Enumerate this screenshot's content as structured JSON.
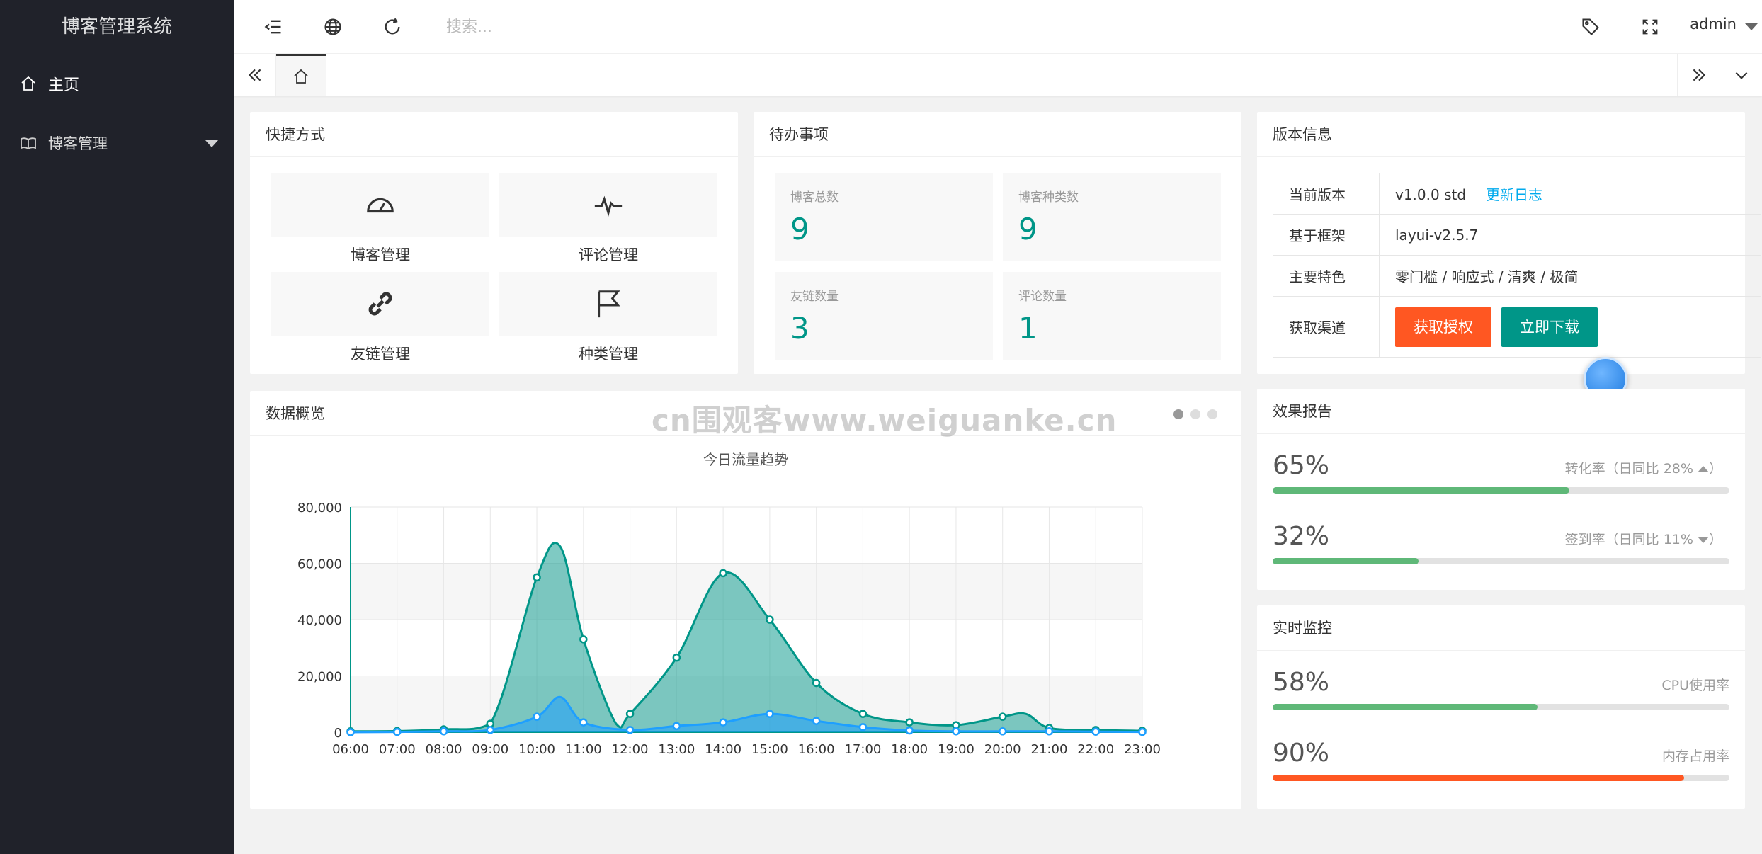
{
  "sidebar": {
    "logo": "博客管理系统",
    "items": [
      {
        "label": "主页",
        "icon": "home-icon"
      },
      {
        "label": "博客管理",
        "icon": "book-icon"
      }
    ]
  },
  "header": {
    "search_placeholder": "搜索...",
    "user": "admin"
  },
  "shortcuts": {
    "title": "快捷方式",
    "items": [
      {
        "label": "博客管理",
        "icon": "gauge-icon"
      },
      {
        "label": "评论管理",
        "icon": "pulse-icon"
      },
      {
        "label": "友链管理",
        "icon": "link-icon"
      },
      {
        "label": "种类管理",
        "icon": "flag-icon"
      }
    ]
  },
  "todo": {
    "title": "待办事项",
    "items": [
      {
        "label": "博客总数",
        "value": "9"
      },
      {
        "label": "博客种类数",
        "value": "9"
      },
      {
        "label": "友链数量",
        "value": "3"
      },
      {
        "label": "评论数量",
        "value": "1"
      }
    ]
  },
  "version": {
    "title": "版本信息",
    "rows": [
      {
        "key": "当前版本",
        "value": "v1.0.0 std",
        "link": "更新日志"
      },
      {
        "key": "基于框架",
        "value": "layui-v2.5.7"
      },
      {
        "key": "主要特色",
        "value": "零门槛 / 响应式 / 清爽 / 极简"
      },
      {
        "key": "获取渠道",
        "btn1": "获取授权",
        "btn2": "立即下载"
      }
    ]
  },
  "overview": {
    "title": "数据概览",
    "watermark": "cn围观客www.weiguanke.cn"
  },
  "chart_data": {
    "type": "area",
    "title": "今日流量趋势",
    "categories": [
      "06:00",
      "07:00",
      "08:00",
      "09:00",
      "10:00",
      "11:00",
      "12:00",
      "13:00",
      "14:00",
      "15:00",
      "16:00",
      "17:00",
      "18:00",
      "19:00",
      "20:00",
      "21:00",
      "22:00",
      "23:00"
    ],
    "ylim": [
      0,
      80000
    ],
    "yticks": [
      "0",
      "20,000",
      "40,000",
      "60,000",
      "80,000"
    ],
    "x": [
      0,
      1,
      2,
      3,
      4,
      5,
      6,
      7,
      8,
      9,
      10,
      11,
      12,
      13,
      14,
      15,
      16,
      17
    ],
    "series": [
      {
        "color": "#009688",
        "values_x": [
          0,
          1,
          2,
          3,
          4,
          4.5,
          5,
          5.7,
          6,
          7,
          8,
          9,
          10,
          11,
          12,
          13,
          14,
          14.5,
          15,
          16,
          17
        ],
        "values": [
          300,
          400,
          1000,
          3000,
          55000,
          66000,
          33000,
          3000,
          6500,
          26500,
          56500,
          40000,
          17500,
          6500,
          3500,
          2500,
          5500,
          6500,
          1500,
          800,
          500
        ]
      },
      {
        "color": "#1e9fff",
        "values_x": [
          0,
          1,
          2,
          3,
          4,
          4.5,
          5,
          6,
          7,
          8,
          9,
          10,
          11,
          12,
          13,
          14,
          15,
          16,
          17
        ],
        "values": [
          0,
          100,
          300,
          800,
          5500,
          12500,
          3500,
          800,
          2200,
          3500,
          6500,
          4000,
          1800,
          600,
          300,
          300,
          300,
          200,
          100
        ]
      }
    ]
  },
  "report": {
    "title": "效果报告",
    "items": [
      {
        "value": "65%",
        "label": "转化率（日同比 28%",
        "trend": "up",
        "pct": 65,
        "color": "#5fb878"
      },
      {
        "value": "32%",
        "label": "签到率（日同比 11%",
        "trend": "down",
        "pct": 32,
        "color": "#5fb878"
      }
    ]
  },
  "monitor": {
    "title": "实时监控",
    "items": [
      {
        "value": "58%",
        "label": "CPU使用率",
        "pct": 58,
        "color": "#5fb878"
      },
      {
        "value": "90%",
        "label": "内存占用率",
        "pct": 90,
        "color": "#ff5722"
      }
    ]
  }
}
